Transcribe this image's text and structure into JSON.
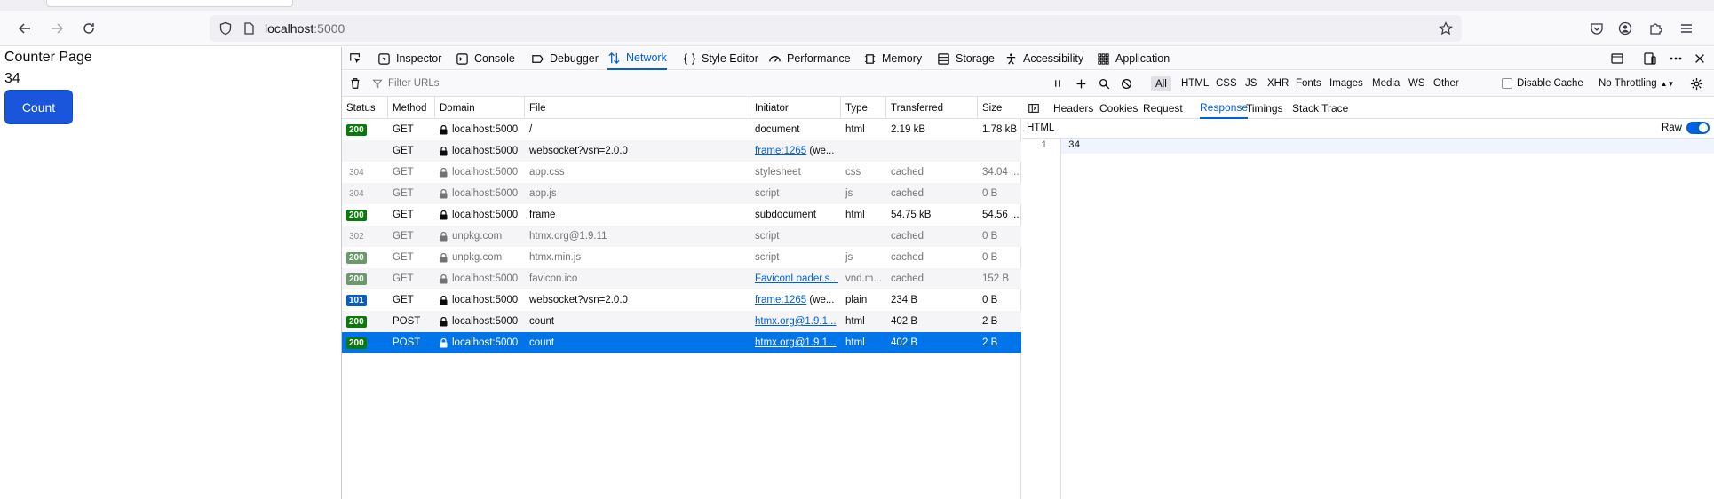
{
  "browser": {
    "url_host": "localhost",
    "url_port": ":5000"
  },
  "page": {
    "title": "Counter Page",
    "counter": "34",
    "button_label": "Count"
  },
  "devtools": {
    "tabs": [
      {
        "label": "Inspector",
        "icon": "inspector-icon"
      },
      {
        "label": "Console",
        "icon": "console-icon"
      },
      {
        "label": "Debugger",
        "icon": "debugger-icon"
      },
      {
        "label": "Network",
        "icon": "network-icon",
        "selected": true
      },
      {
        "label": "Style Editor",
        "icon": "style-editor-icon"
      },
      {
        "label": "Performance",
        "icon": "performance-icon"
      },
      {
        "label": "Memory",
        "icon": "memory-icon"
      },
      {
        "label": "Storage",
        "icon": "storage-icon"
      },
      {
        "label": "Accessibility",
        "icon": "accessibility-icon"
      },
      {
        "label": "Application",
        "icon": "application-icon"
      }
    ],
    "filter_placeholder": "Filter URLs",
    "type_filters": [
      "All",
      "HTML",
      "CSS",
      "JS",
      "XHR",
      "Fonts",
      "Images",
      "Media",
      "WS",
      "Other"
    ],
    "selected_filter": "All",
    "disable_cache_label": "Disable Cache",
    "throttling_label": "No Throttling",
    "columns": [
      "Status",
      "Method",
      "Domain",
      "File",
      "Initiator",
      "Type",
      "Transferred",
      "Size"
    ],
    "requests": [
      {
        "status": "200",
        "method": "GET",
        "domain": "localhost:5000",
        "file": "/",
        "initiator": "document",
        "initiator_link": false,
        "type": "html",
        "transferred": "2.19 kB",
        "size": "1.78 kB",
        "cached": false
      },
      {
        "status": "",
        "method": "GET",
        "domain": "localhost:5000",
        "file": "websocket?vsn=2.0.0",
        "initiator": "frame:1265",
        "initiator_suffix": "(we...",
        "initiator_link": true,
        "type": "",
        "transferred": "",
        "size": "",
        "cached": false
      },
      {
        "status": "304",
        "method": "GET",
        "domain": "localhost:5000",
        "file": "app.css",
        "initiator": "stylesheet",
        "initiator_link": false,
        "type": "css",
        "transferred": "cached",
        "size": "34.04 ...",
        "cached": true
      },
      {
        "status": "304",
        "method": "GET",
        "domain": "localhost:5000",
        "file": "app.js",
        "initiator": "script",
        "initiator_link": false,
        "type": "js",
        "transferred": "cached",
        "size": "0 B",
        "cached": true
      },
      {
        "status": "200",
        "method": "GET",
        "domain": "localhost:5000",
        "file": "frame",
        "initiator": "subdocument",
        "initiator_link": false,
        "type": "html",
        "transferred": "54.75 kB",
        "size": "54.56 ...",
        "cached": false
      },
      {
        "status": "302",
        "method": "GET",
        "domain": "unpkg.com",
        "file": "htmx.org@1.9.11",
        "initiator": "script",
        "initiator_link": false,
        "type": "",
        "transferred": "cached",
        "size": "0 B",
        "cached": true
      },
      {
        "status": "200",
        "method": "GET",
        "domain": "unpkg.com",
        "file": "htmx.min.js",
        "initiator": "script",
        "initiator_link": false,
        "type": "js",
        "transferred": "cached",
        "size": "0 B",
        "cached": true
      },
      {
        "status": "200",
        "method": "GET",
        "domain": "localhost:5000",
        "file": "favicon.ico",
        "initiator": "FaviconLoader.s...",
        "initiator_link": true,
        "type": "vnd.m...",
        "transferred": "cached",
        "size": "152 B",
        "cached": true
      },
      {
        "status": "101",
        "method": "GET",
        "domain": "localhost:5000",
        "file": "websocket?vsn=2.0.0",
        "initiator": "frame:1265",
        "initiator_suffix": "(we...",
        "initiator_link": true,
        "type": "plain",
        "transferred": "234 B",
        "size": "0 B",
        "cached": false
      },
      {
        "status": "200",
        "method": "POST",
        "domain": "localhost:5000",
        "file": "count",
        "initiator": "htmx.org@1.9.1...",
        "initiator_link": true,
        "type": "html",
        "transferred": "402 B",
        "size": "2 B",
        "cached": false
      },
      {
        "status": "200",
        "method": "POST",
        "domain": "localhost:5000",
        "file": "count",
        "initiator": "htmx.org@1.9.1...",
        "initiator_link": true,
        "type": "html",
        "transferred": "402 B",
        "size": "2 B",
        "cached": false,
        "selected": true
      }
    ],
    "detail_tabs": [
      "Headers",
      "Cookies",
      "Request",
      "Response",
      "Timings",
      "Stack Trace"
    ],
    "selected_detail_tab": "Response",
    "response_format": "HTML",
    "raw_label": "Raw",
    "raw_enabled": true,
    "response_lines": [
      {
        "num": "1",
        "text": "34"
      }
    ]
  }
}
